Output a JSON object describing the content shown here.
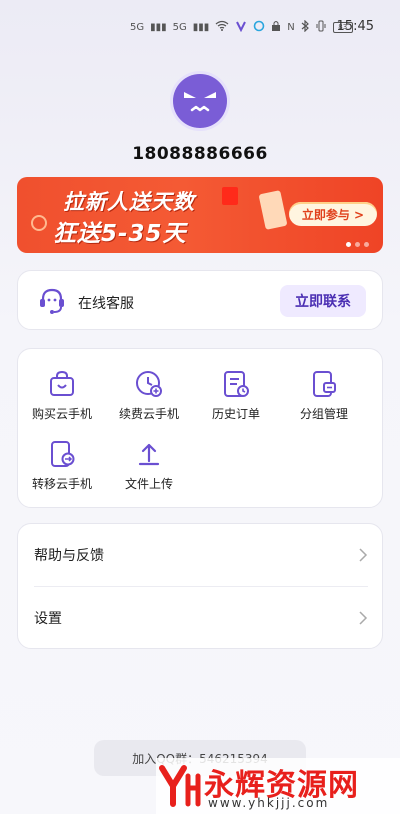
{
  "status_bar": {
    "icons_left": [
      "5G",
      "5G"
    ],
    "nfc_label": "N",
    "battery": "83",
    "time": "15:45"
  },
  "profile": {
    "phone": "18088886666"
  },
  "banner": {
    "line1": "拉新人送天数",
    "line2": "狂送5-35天",
    "cta": "立即参与 >",
    "colors": {
      "bg": "#f0502e",
      "cta_bg": "#fff5e0"
    }
  },
  "service": {
    "label": "在线客服",
    "button": "立即联系"
  },
  "menu": {
    "items": [
      {
        "label": "购买云手机",
        "icon": "shopping-bag-icon"
      },
      {
        "label": "续费云手机",
        "icon": "clock-plus-icon"
      },
      {
        "label": "历史订单",
        "icon": "order-history-icon"
      },
      {
        "label": "分组管理",
        "icon": "group-manage-icon"
      },
      {
        "label": "转移云手机",
        "icon": "transfer-icon"
      },
      {
        "label": "文件上传",
        "icon": "upload-icon"
      }
    ]
  },
  "list": {
    "items": [
      {
        "label": "帮助与反馈"
      },
      {
        "label": "设置"
      }
    ]
  },
  "qq_group": {
    "text": "加入QQ群：546215394"
  },
  "watermark": {
    "title": "永辉资源网",
    "url": "www.yhkjjj.com"
  },
  "colors": {
    "accent": "#4b2fb3",
    "icon_purple": "#6a4fd1",
    "banner_red": "#f0502e"
  }
}
